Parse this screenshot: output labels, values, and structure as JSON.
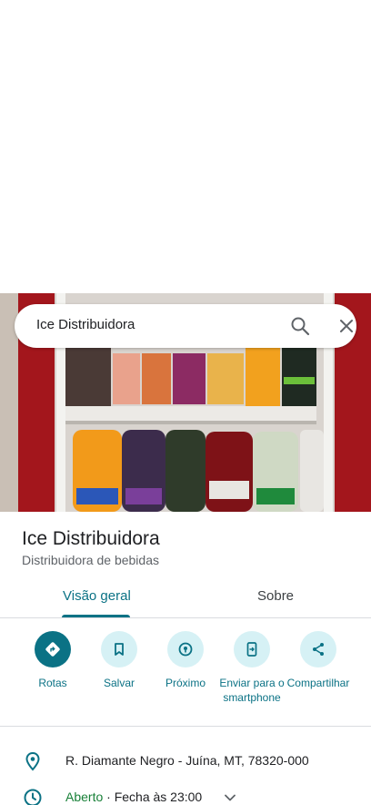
{
  "search": {
    "query": "Ice Distribuidora"
  },
  "place": {
    "name": "Ice Distribuidora",
    "category": "Distribuidora de bebidas"
  },
  "tabs": {
    "overview": "Visão geral",
    "about": "Sobre"
  },
  "actions": [
    {
      "label": "Rotas",
      "icon": "directions-icon"
    },
    {
      "label": "Salvar",
      "icon": "bookmark-icon"
    },
    {
      "label": "Próximo",
      "icon": "nearby-icon"
    },
    {
      "label": "Enviar para o smartphone",
      "icon": "send-to-phone-icon"
    },
    {
      "label": "Compartilhar",
      "icon": "share-icon"
    }
  ],
  "info": {
    "address": "R. Diamante Negro - Juína, MT, 78320-000",
    "status_open": "Aberto",
    "status_hours": " · Fecha às 23:00"
  },
  "colors": {
    "accent": "#0b7285",
    "accent_light": "#d6f1f5",
    "open": "#188038"
  }
}
